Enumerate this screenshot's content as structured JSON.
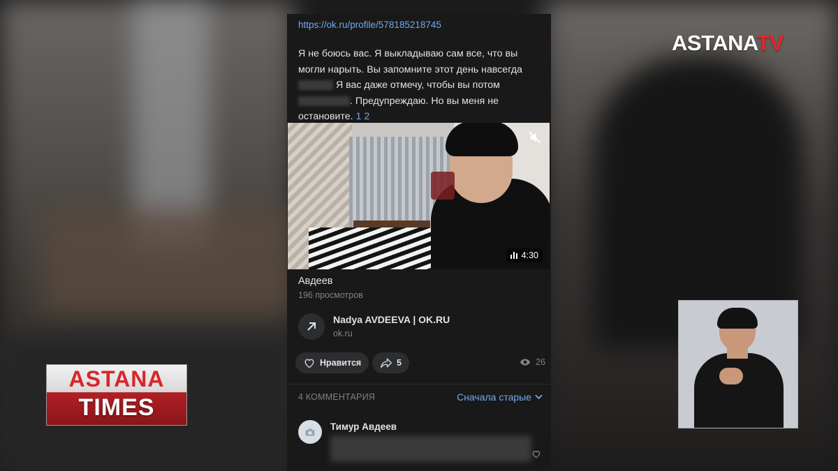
{
  "post": {
    "link": "https://ok.ru/profile/578185218745",
    "text_line1": "Я не боюсь вас. Я выкладываю сам все, что вы могли нарыть. Вы запомните этот день навсегда",
    "text_line2": " Я вас даже отмечу, чтобы вы потом",
    "text_line3": ". Предупреждаю. Но вы меня не остановите.",
    "more_links": "1 2"
  },
  "video": {
    "duration": "4:30",
    "title": "Авдеев",
    "views": "196 просмотров",
    "mute_icon": "mute-icon",
    "bars_icon": "bars-icon"
  },
  "link_card": {
    "title": "Nadya AVDEEVA | OK.RU",
    "domain": "ok.ru",
    "icon": "arrow-up-right-icon"
  },
  "actions": {
    "like_label": "Нравится",
    "share_count": "5",
    "views_count": "26"
  },
  "comments": {
    "count_label": "4 КОММЕНТАРИЯ",
    "sort_label": "Сначала старые",
    "items": [
      {
        "author": "Тимур Авдеев"
      }
    ]
  },
  "overlays": {
    "channel_logo_main": "ASTANA",
    "channel_logo_tv": "TV",
    "program_top": "ASTANA",
    "program_bottom": "TIMES"
  },
  "colors": {
    "link_blue": "#71aaeb",
    "screen_bg": "#19191a",
    "pill_bg": "#2c2d2e",
    "logo_red": "#e4252b"
  }
}
